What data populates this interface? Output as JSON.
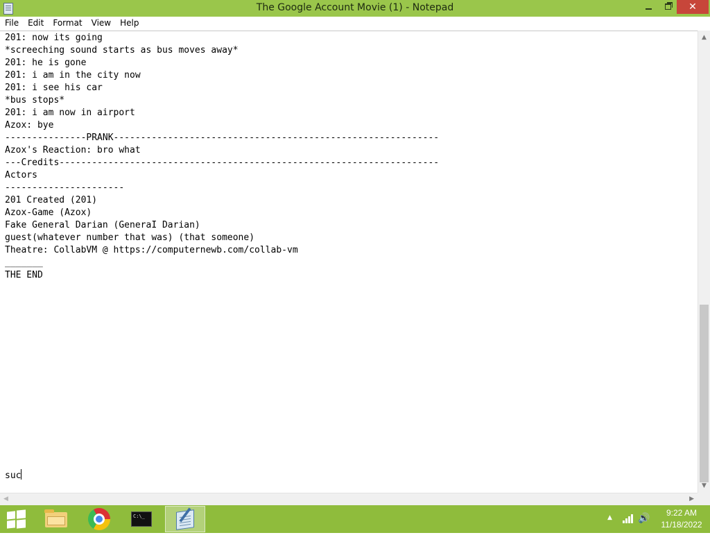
{
  "window": {
    "title": "The Google Account Movie (1) - Notepad",
    "close_glyph": "✕"
  },
  "menu": [
    "File",
    "Edit",
    "Format",
    "View",
    "Help"
  ],
  "document": {
    "lines": [
      "201: now its going",
      "*screeching sound starts as bus moves away*",
      "201: he is gone",
      "201: i am in the city now",
      "201: i see his car",
      "*bus stops*",
      "201: i am now in airport",
      "Azox: bye",
      "---------------PRANK------------------------------------------------------------",
      "Azox's Reaction: bro what",
      "---Credits----------------------------------------------------------------------",
      "Actors",
      "----------------------",
      "201 Created (201)",
      "Azox-Game (Azox)",
      "Fake General Darian (GeneraI Darian)",
      "guest(whatever number that was) (that someone)",
      "Theatre: CollabVM @ https://computernewb.com/collab-vm",
      "_______",
      "THE END",
      "",
      "",
      "",
      "",
      "",
      "",
      "",
      "",
      "",
      "",
      "",
      "",
      "",
      "",
      "",
      "suc"
    ]
  },
  "taskbar": {
    "items": [
      {
        "name": "file-explorer",
        "active": false
      },
      {
        "name": "google-chrome",
        "active": false
      },
      {
        "name": "command-prompt",
        "active": false
      },
      {
        "name": "notepad",
        "active": true
      }
    ],
    "cmd_glyph": "C:\\_"
  },
  "clock": {
    "time": "9:22 AM",
    "date": "11/18/2022"
  },
  "colors": {
    "accent": "#9ac64b",
    "taskbar": "#8fbc3c",
    "close": "#c7463a"
  }
}
